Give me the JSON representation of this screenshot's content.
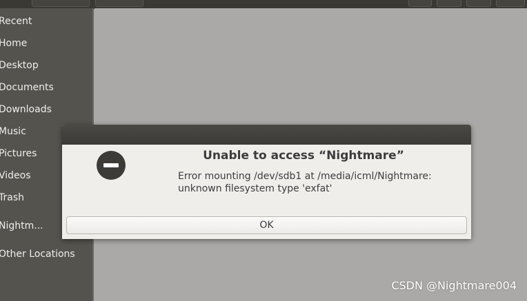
{
  "sidebar": {
    "items": [
      {
        "label": "Recent"
      },
      {
        "label": "Home"
      },
      {
        "label": "Desktop"
      },
      {
        "label": "Documents"
      },
      {
        "label": "Downloads"
      },
      {
        "label": "Music"
      },
      {
        "label": "Pictures"
      },
      {
        "label": "Videos"
      },
      {
        "label": "Trash"
      },
      {
        "label": "Nightm..."
      },
      {
        "label": "Other Locations"
      }
    ]
  },
  "dialog": {
    "icon": "error-minus-circle-icon",
    "title": "Unable to access “Nightmare”",
    "message_line1": "Error mounting /dev/sdb1 at /media/icml/Nightmare:",
    "message_line2": "unknown filesystem type 'exfat'",
    "ok_label": "OK"
  },
  "watermark": "CSDN @Nightmare004"
}
